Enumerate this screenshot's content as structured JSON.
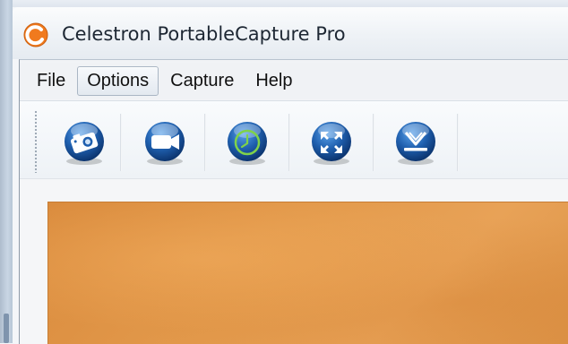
{
  "window": {
    "title": "Celestron PortableCapture Pro",
    "app_icon": "celestron-swirl-icon"
  },
  "menubar": {
    "items": [
      {
        "label": "File",
        "state": "normal"
      },
      {
        "label": "Options",
        "state": "hover"
      },
      {
        "label": "Capture",
        "state": "normal"
      },
      {
        "label": "Help",
        "state": "normal"
      }
    ]
  },
  "toolbar": {
    "buttons": [
      {
        "icon": "photo-camera-icon",
        "tooltip": ""
      },
      {
        "icon": "video-camera-icon",
        "tooltip": ""
      },
      {
        "icon": "timer-clock-icon",
        "tooltip": ""
      },
      {
        "icon": "fullscreen-expand-icon",
        "tooltip": ""
      },
      {
        "icon": "download-save-icon",
        "tooltip": ""
      }
    ]
  },
  "colors": {
    "accent_blue": "#1f5fae",
    "preview_orange": "#e39a4c",
    "clock_green": "#6fc13a",
    "logo_orange": "#f07a1e"
  }
}
